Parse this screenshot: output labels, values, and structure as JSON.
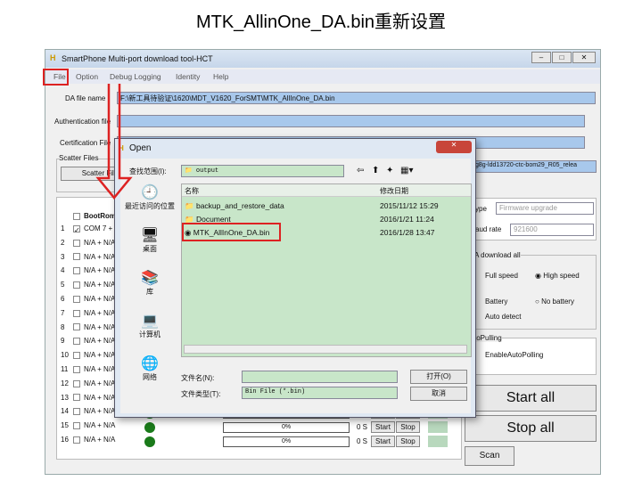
{
  "slide_title": "MTK_AllinOne_DA.bin重新设置",
  "window": {
    "title": "SmartPhone Multi-port download tool-HCT",
    "menu": [
      "File",
      "Option",
      "Debug Logging",
      "Identity",
      "Help"
    ],
    "da_label": "DA file name",
    "da_value": "F:\\新工具待验证\\1620\\MDT_V1620_ForSMT\\MTK_AllInOne_DA.bin",
    "auth_label": "Authentication file",
    "cert_label": "Certification File",
    "scatter_group": "Scatter Files",
    "scatter_button": "Scatter File",
    "scatter_value": "g8g-ldd13720-ctc-bom29_R05_relea",
    "bootrom_label": "BootRom",
    "ports": [
      {
        "n": "1",
        "name": "COM 7 + I",
        "checked": true
      },
      {
        "n": "2",
        "name": "N/A + N/A"
      },
      {
        "n": "3",
        "name": "N/A + N/A"
      },
      {
        "n": "4",
        "name": "N/A + N/A"
      },
      {
        "n": "5",
        "name": "N/A + N/A"
      },
      {
        "n": "6",
        "name": "N/A + N/A"
      },
      {
        "n": "7",
        "name": "N/A + N/A"
      },
      {
        "n": "8",
        "name": "N/A + N/A"
      },
      {
        "n": "9",
        "name": "N/A + N/A"
      },
      {
        "n": "10",
        "name": "N/A + N/A"
      },
      {
        "n": "11",
        "name": "N/A + N/A"
      },
      {
        "n": "12",
        "name": "N/A + N/A"
      },
      {
        "n": "13",
        "name": "N/A + N/A"
      },
      {
        "n": "14",
        "name": "N/A + N/A"
      },
      {
        "n": "15",
        "name": "N/A + N/A"
      },
      {
        "n": "16",
        "name": "N/A + N/A"
      }
    ],
    "port_progress": "0%",
    "port_time": "0 S",
    "start": "Start",
    "stop": "Stop",
    "type_label": "ype",
    "type_value": "Firmware upgrade",
    "baud_label": "aud rate",
    "baud_value": "921600",
    "da_group": "A download all",
    "full_speed": "Full speed",
    "high_speed": "High speed",
    "battery": "Battery",
    "no_battery": "No battery",
    "auto_detect": "Auto detect",
    "autopolling_group": "toPulling",
    "enable_autopolling": "EnableAutoPolling",
    "start_all": "Start all",
    "stop_all": "Stop all",
    "scan": "Scan"
  },
  "dialog": {
    "title": "Open",
    "lookin_label": "查找范围(I):",
    "lookin_value": "output",
    "places": [
      "最近访问的位置",
      "桌面",
      "库",
      "计算机",
      "网络"
    ],
    "col_name": "名称",
    "col_date": "修改日期",
    "files": [
      {
        "name": "backup_and_restore_data",
        "date": "2015/11/12 15:29",
        "type": "folder"
      },
      {
        "name": "Document",
        "date": "2016/1/21 11:24",
        "type": "folder"
      },
      {
        "name": "MTK_AllInOne_DA.bin",
        "date": "2016/1/28 13:47",
        "type": "bin"
      }
    ],
    "filename_label": "文件名(N):",
    "filename_value": "",
    "filetype_label": "文件类型(T):",
    "filetype_value": "Bin File (*.bin)",
    "open_button": "打开(O)",
    "cancel_button": "取消"
  },
  "colors": {
    "highlight": "#dd2222",
    "field_blue": "#a8c8ec",
    "list_green": "#c8e6c9",
    "status_green": "#1a7a1a"
  }
}
